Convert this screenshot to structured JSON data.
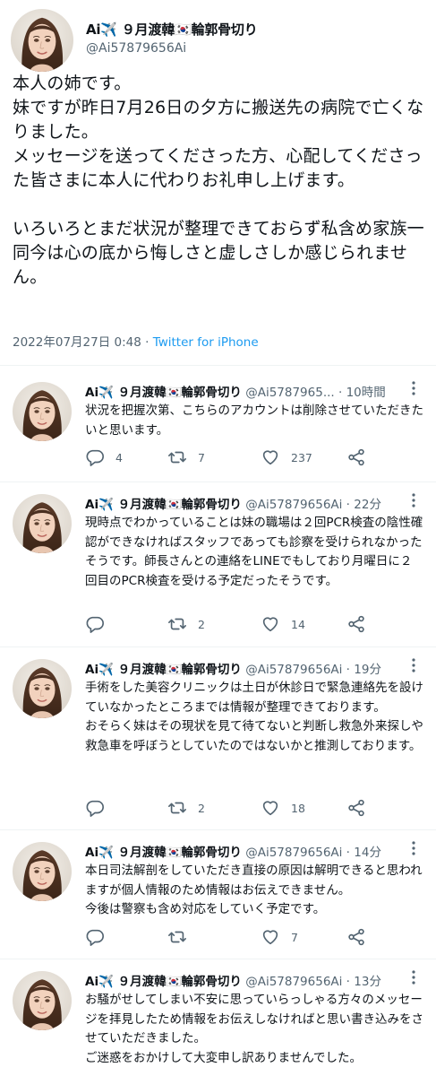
{
  "colors": {
    "link": "#1d9bf0",
    "secondary": "#536471",
    "text": "#0f1419",
    "divider": "#eff3f4"
  },
  "icons": [
    "avatar",
    "reply-icon",
    "retweet-icon",
    "like-icon",
    "share-icon",
    "more-icon"
  ],
  "main_tweet": {
    "name": "Ai✈️ ９月渡韓🇰🇷輪郭骨切り",
    "handle": "@Ai57879656Ai",
    "body": "本人の姉です。\n妹ですが昨日7月26日の夕方に搬送先の病院で亡くなりました。\nメッセージを送ってくださった方、心配してくださった皆さまに本人に代わりお礼申し上げます。\n\nいろいろとまだ状況が整理できておらず私含め家族一同今は心の底から悔しさと虚しさしか感じられません。",
    "date": "2022年07月27日 0:48",
    "separator": " · ",
    "source": "Twitter for iPhone"
  },
  "replies": [
    {
      "name": "Ai✈️ ９月渡韓🇰🇷輪郭骨切り",
      "handle": "@Ai5787965...",
      "time": "10時間",
      "text": "状況を把握次第、こちらのアカウントは削除させていただきたいと思います。",
      "replies": "4",
      "retweets": "7",
      "likes": "237"
    },
    {
      "name": "Ai✈️ ９月渡韓🇰🇷輪郭骨切り",
      "handle": "@Ai57879656Ai",
      "time": "22分",
      "text": "現時点でわかっていることは妹の職場は２回PCR検査の陰性確認ができなければスタッフであっても診察を受けられなかったそうです。師長さんとの連絡をLINEでもしており月曜日に２回目のPCR検査を受ける予定だったそうです。",
      "replies": "",
      "retweets": "2",
      "likes": "14"
    },
    {
      "name": "Ai✈️ ９月渡韓🇰🇷輪郭骨切り",
      "handle": "@Ai57879656Ai",
      "time": "19分",
      "text": "手術をした美容クリニックは土日が休診日で緊急連絡先を設けていなかったところまでは情報が整理できております。\nおそらく妹はその現状を見て待てないと判断し救急外来探しや救急車を呼ぼうとしていたのではないかと推測しております。",
      "replies": "",
      "retweets": "2",
      "likes": "18"
    },
    {
      "name": "Ai✈️ ９月渡韓🇰🇷輪郭骨切り",
      "handle": "@Ai57879656Ai",
      "time": "14分",
      "text": "本日司法解剖をしていただき直接の原因は解明できると思われますが個人情報のため情報はお伝えできません。\n今後は警察も含め対応をしていく予定です。",
      "replies": "",
      "retweets": "",
      "likes": "7"
    },
    {
      "name": "Ai✈️ ９月渡韓🇰🇷輪郭骨切り",
      "handle": "@Ai57879656Ai",
      "time": "13分",
      "text": "お騒がせしてしまい不安に思っていらっしゃる方々のメッセージを拝見したため情報をお伝えしなければと思い書き込みをさせていただきました。\nご迷惑をおかけして大変申し訳ありませんでした。",
      "replies": "",
      "retweets": "",
      "likes": ""
    }
  ]
}
